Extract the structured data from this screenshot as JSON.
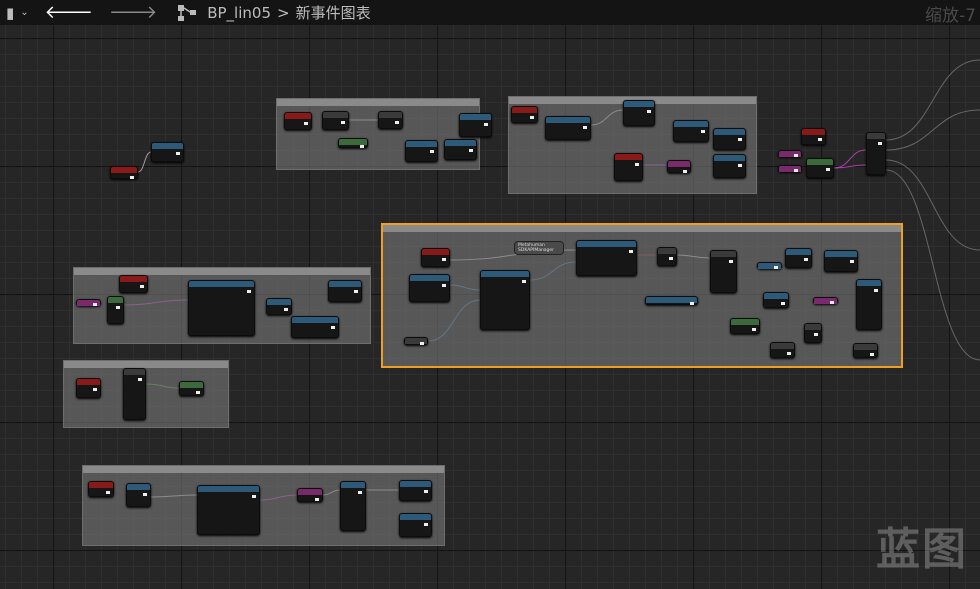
{
  "toolbar": {
    "blueprint": "BP_lin05",
    "separator": ">",
    "graph": "新事件图表",
    "zoom": "缩放-7"
  },
  "graph": {
    "selected_node_label": "Metahuman SDKAPIManager"
  },
  "watermark": "蓝图",
  "colors": {
    "background": "#262626",
    "selection": "#f0a020",
    "event": "#8a1a1a",
    "function": "#2e5a7a"
  }
}
